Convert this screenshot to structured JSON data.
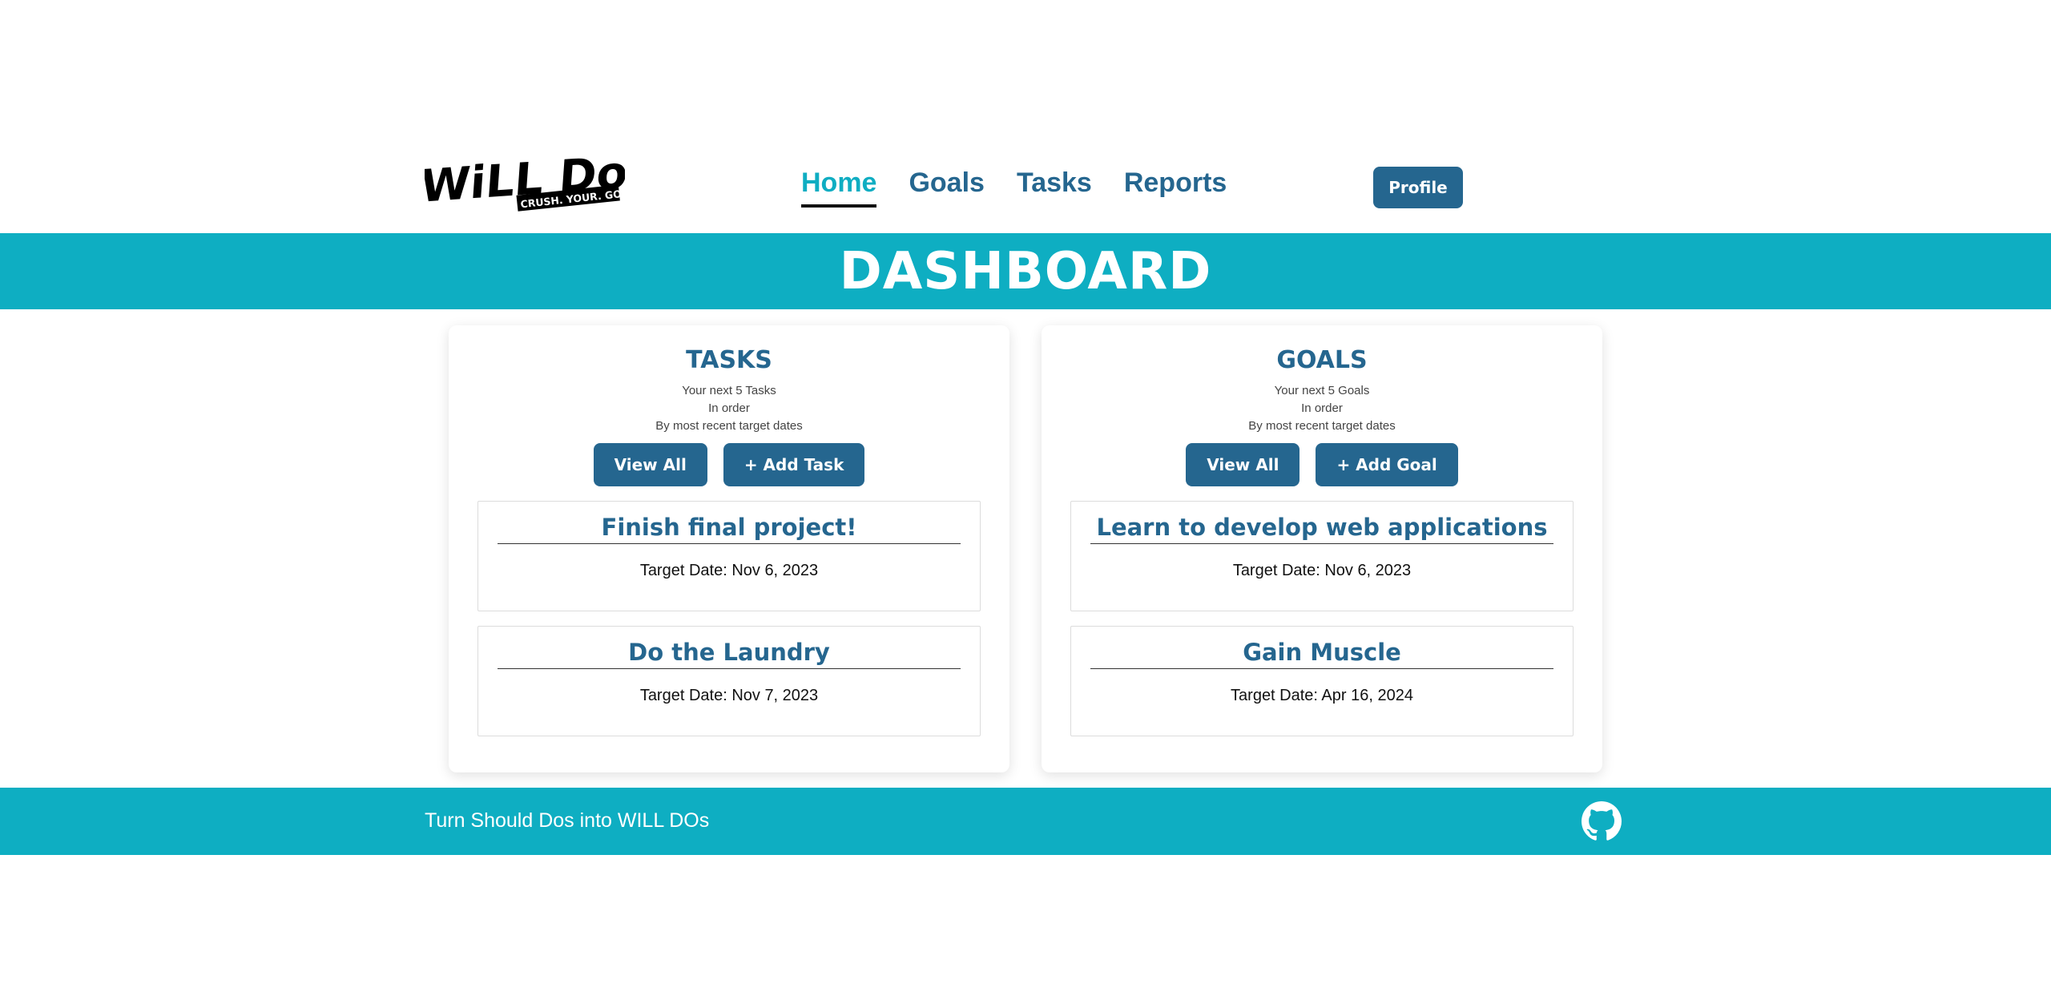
{
  "brand": {
    "logo_main": "WiLL Do",
    "logo_tagline": "CRUSH. YOUR. GOALS."
  },
  "nav": {
    "links": [
      "Home",
      "Goals",
      "Tasks",
      "Reports"
    ],
    "active": "Home",
    "profile_label": "Profile"
  },
  "banner": {
    "title": "DASHBOARD"
  },
  "tasks_panel": {
    "title": "TASKS",
    "sub_lines": [
      "Your next 5 Tasks",
      "In order",
      "By most recent target dates"
    ],
    "view_all_label": "View All",
    "add_label": "+ Add Task",
    "items": [
      {
        "title": "Finish final project!",
        "date": "Target Date: Nov 6, 2023"
      },
      {
        "title": "Do the Laundry",
        "date": "Target Date: Nov 7, 2023"
      }
    ]
  },
  "goals_panel": {
    "title": "GOALS",
    "sub_lines": [
      "Your next 5 Goals",
      "In order",
      "By most recent target dates"
    ],
    "view_all_label": "View All",
    "add_label": "+ Add Goal",
    "items": [
      {
        "title": "Learn to develop web applications",
        "date": "Target Date: Nov 6, 2023"
      },
      {
        "title": "Gain Muscle",
        "date": "Target Date: Apr 16, 2024"
      }
    ]
  },
  "footer": {
    "tagline": "Turn Should Dos into WILL DOs",
    "icon": "github-icon"
  },
  "colors": {
    "teal": "#0eaec2",
    "navy": "#25668f",
    "active_nav": "#0fadc2"
  }
}
